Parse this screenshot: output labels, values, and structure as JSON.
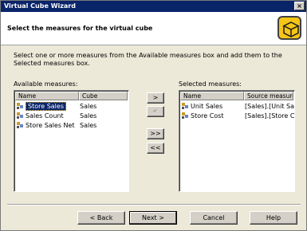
{
  "window": {
    "title": "Virtual Cube Wizard",
    "close_glyph": "×"
  },
  "header": {
    "title": "Select the measures for the virtual cube",
    "icon": "cube-icon",
    "icon_color": "#f5c518"
  },
  "instructions": "Select one or more measures from the Available measures box and add them to the Selected measures box.",
  "available": {
    "label": "Available measures:",
    "columns": [
      "Name",
      "Cube"
    ],
    "rows": [
      {
        "name": "Store Sales",
        "cube": "Sales",
        "selected": true
      },
      {
        "name": "Sales Count",
        "cube": "Sales",
        "selected": false
      },
      {
        "name": "Store Sales Net",
        "cube": "Sales",
        "selected": false
      }
    ]
  },
  "selected": {
    "label": "Selected measures:",
    "columns": [
      "Name",
      "Source measure"
    ],
    "rows": [
      {
        "name": "Unit Sales",
        "source": "[Sales].[Unit Sales]"
      },
      {
        "name": "Store Cost",
        "source": "[Sales].[Store Cost]"
      }
    ]
  },
  "transfer": {
    "add": ">",
    "remove": "<",
    "add_all": ">>",
    "remove_all": "<<"
  },
  "footer": {
    "back": "< Back",
    "next": "Next >",
    "cancel": "Cancel",
    "help": "Help"
  }
}
